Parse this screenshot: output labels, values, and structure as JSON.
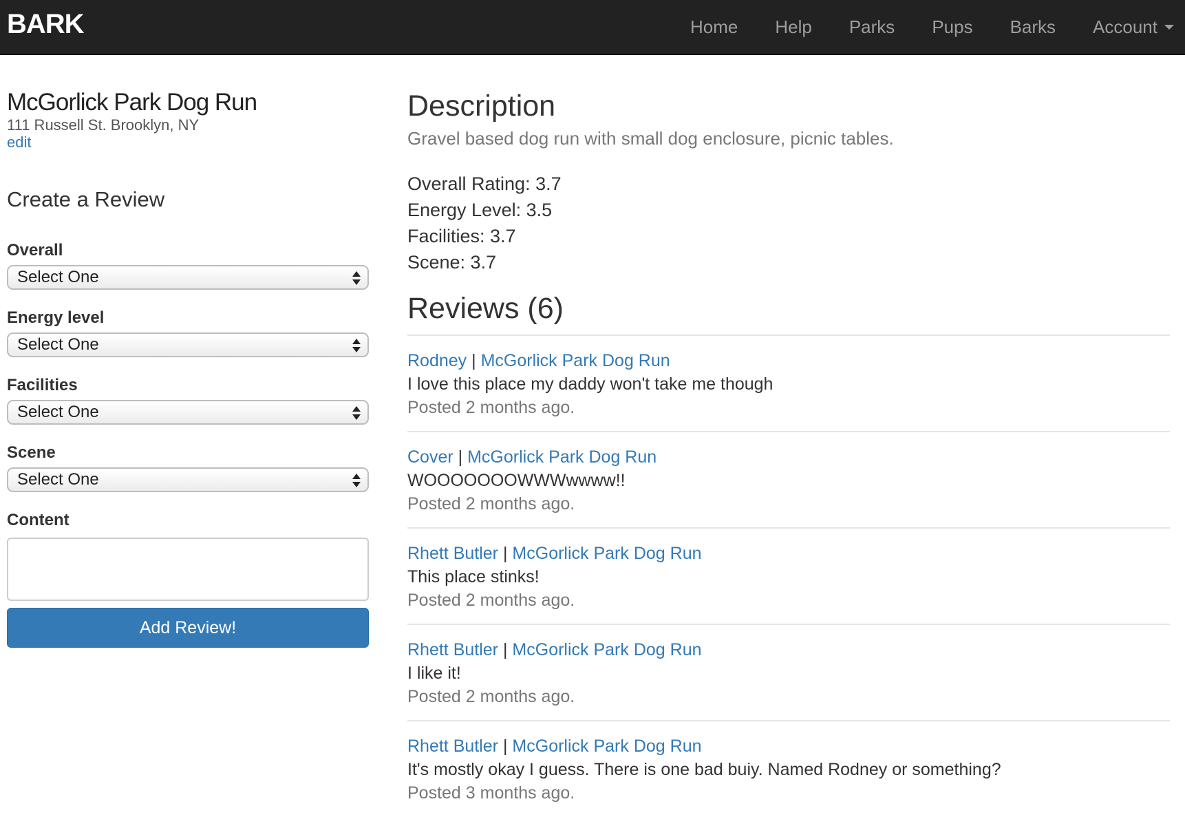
{
  "navbar": {
    "brand": "BARK",
    "items": [
      "Home",
      "Help",
      "Parks",
      "Pups",
      "Barks"
    ],
    "account_label": "Account"
  },
  "park": {
    "name": "McGorlick Park Dog Run",
    "address": "111 Russell St. Brooklyn, NY",
    "edit_label": "edit"
  },
  "review_form": {
    "title": "Create a Review",
    "fields": [
      {
        "label": "Overall",
        "selected": "Select One"
      },
      {
        "label": "Energy level",
        "selected": "Select One"
      },
      {
        "label": "Facilities",
        "selected": "Select One"
      },
      {
        "label": "Scene",
        "selected": "Select One"
      }
    ],
    "content_label": "Content",
    "content_value": "",
    "submit_label": "Add Review!"
  },
  "description": {
    "heading": "Description",
    "text": "Gravel based dog run with small dog enclosure, picnic tables.",
    "ratings": [
      "Overall Rating: 3.7",
      "Energy Level: 3.5",
      "Facilities: 3.7",
      "Scene: 3.7"
    ]
  },
  "reviews": {
    "heading": "Reviews (6)",
    "separator": "|",
    "items": [
      {
        "author": "Rodney",
        "park": "McGorlick Park Dog Run",
        "text": "I love this place my daddy won't take me though",
        "posted": "Posted 2 months ago."
      },
      {
        "author": "Cover",
        "park": "McGorlick Park Dog Run",
        "text": "WOOOOOOOWWWwwww!!",
        "posted": "Posted 2 months ago."
      },
      {
        "author": "Rhett Butler",
        "park": "McGorlick Park Dog Run",
        "text": "This place stinks!",
        "posted": "Posted 2 months ago."
      },
      {
        "author": "Rhett Butler",
        "park": "McGorlick Park Dog Run",
        "text": "I like it!",
        "posted": "Posted 2 months ago."
      },
      {
        "author": "Rhett Butler",
        "park": "McGorlick Park Dog Run",
        "text": "It's mostly okay I guess. There is one bad buiy. Named Rodney or something?",
        "posted": "Posted 3 months ago."
      }
    ]
  },
  "colors": {
    "navbar_bg": "#222222",
    "link": "#337ab7",
    "primary_button": "#337ab7",
    "muted_text": "#777777"
  }
}
